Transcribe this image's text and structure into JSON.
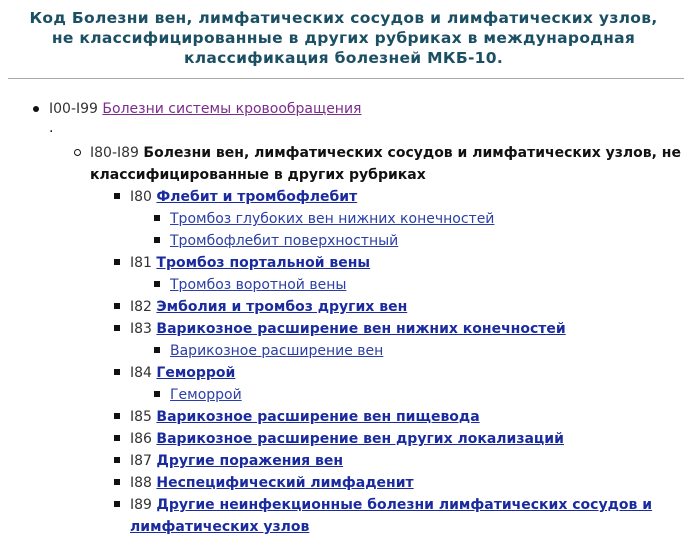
{
  "title": {
    "line1": "Код Болезни вен, лимфатических сосудов и лимфатических узлов,",
    "line2": "не классифицированные в других рубриках в международная",
    "line3": "классификация болезней МКБ-10."
  },
  "level1": {
    "code": "I00-I99",
    "label": "Болезни системы кровообращения",
    "after": "."
  },
  "level2": {
    "code": "I80-I89",
    "label_line1": "Болезни вен, лимфатических сосудов и лимфатических узлов, не",
    "label_line2": "классифицированные в других рубриках"
  },
  "items": [
    {
      "code": "I80",
      "label": "Флебит и тромбофлебит",
      "subitems": [
        "Тромбоз глубоких вен нижних конечностей",
        "Тромбофлебит поверхностный"
      ]
    },
    {
      "code": "I81",
      "label": "Тромбоз портальной вены",
      "subitems": [
        "Тромбоз воротной вены"
      ]
    },
    {
      "code": "I82",
      "label": "Эмболия и тромбоз других вен",
      "subitems": []
    },
    {
      "code": "I83",
      "label": "Варикозное расширение вен нижних конечностей",
      "subitems": [
        "Варикозное расширение вен"
      ]
    },
    {
      "code": "I84",
      "label": "Геморрой",
      "subitems": [
        "Геморрой"
      ]
    },
    {
      "code": "I85",
      "label": "Варикозное расширение вен пищевода",
      "subitems": []
    },
    {
      "code": "I86",
      "label": "Варикозное расширение вен других локализаций",
      "subitems": []
    },
    {
      "code": "I87",
      "label": "Другие поражения вен",
      "subitems": []
    },
    {
      "code": "I88",
      "label": "Неспецифический лимфаденит",
      "subitems": []
    },
    {
      "code": "I89",
      "label_line1": "Другие неинфекционные болезни лимфатических сосудов и",
      "label_line2": "лимфатических узлов",
      "subitems": []
    }
  ]
}
